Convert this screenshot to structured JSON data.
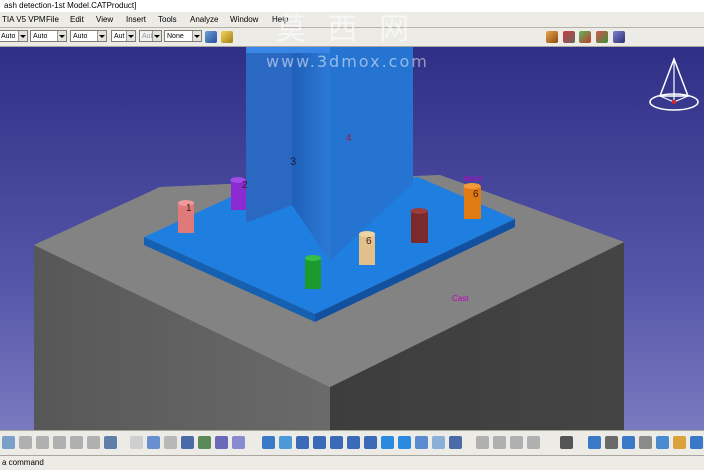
{
  "window": {
    "title": "ash detection-1st Model.CATProduct]"
  },
  "menu": [
    {
      "label": "TIA V5 VPM"
    },
    {
      "label": "File"
    },
    {
      "label": "Edit"
    },
    {
      "label": "View"
    },
    {
      "label": "Insert"
    },
    {
      "label": "Tools"
    },
    {
      "label": "Analyze"
    },
    {
      "label": "Window"
    },
    {
      "label": "Help"
    }
  ],
  "toolbar": {
    "combos": [
      {
        "value": "Auto"
      },
      {
        "value": "Auto"
      },
      {
        "value": "Auto"
      },
      {
        "value": "Aut"
      },
      {
        "value": "Aut"
      },
      {
        "value": "None"
      }
    ]
  },
  "scene": {
    "bolt_labels": [
      "1",
      "2",
      "6",
      "6"
    ],
    "plate_labels": [
      "3",
      "4"
    ],
    "pink_labels": [
      "Bolt-8",
      "Cast"
    ],
    "colors": {
      "background": "#3f4096",
      "plate": "#1f7fe0",
      "column": "#2470c8",
      "concrete": "#5a5a5a",
      "pink": "#c000c0"
    }
  },
  "watermark": {
    "big": "莫 西 网",
    "url": "www.3dmox.com"
  },
  "status": {
    "text": "a command"
  }
}
